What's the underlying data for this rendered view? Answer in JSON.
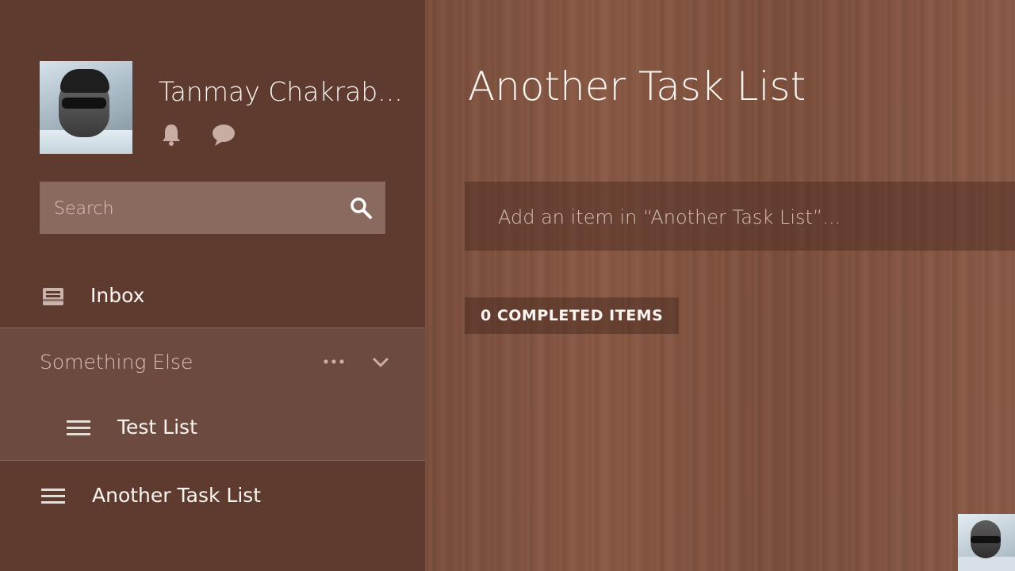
{
  "user": {
    "name": "Tanmay Chakrab..."
  },
  "icons": {
    "notifications": "bell-icon",
    "messages": "chat-icon",
    "search": "search-icon",
    "inbox": "inbox-icon",
    "list": "hamburger-list-icon",
    "more": "more-dots-icon",
    "expand": "chevron-down-icon"
  },
  "search": {
    "placeholder": "Search"
  },
  "sidebar": {
    "inbox_label": "Inbox",
    "group": {
      "label": "Something Else",
      "items": [
        {
          "label": "Test List"
        }
      ]
    },
    "lists": [
      {
        "label": "Another Task List"
      }
    ]
  },
  "main": {
    "title": "Another Task List",
    "add_item_placeholder": "Add an item in “Another Task List”...",
    "completed_label": "0 COMPLETED ITEMS"
  },
  "colors": {
    "sidebar_bg": "#5f3a2f",
    "search_bg": "#8a6a5f",
    "group_bg": "#6d4a40",
    "main_bg": "#84543f",
    "text": "#fbf5f2"
  }
}
